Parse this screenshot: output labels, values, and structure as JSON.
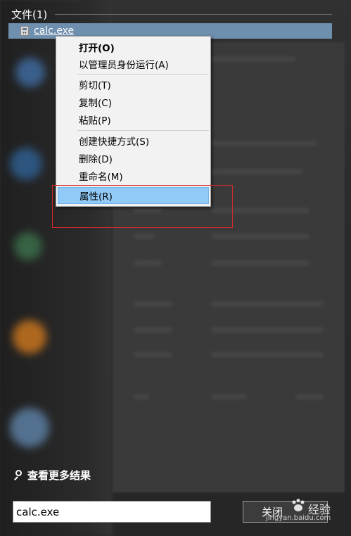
{
  "header": {
    "files_label": "文件(1)"
  },
  "results": {
    "selected_file": "calc.exe"
  },
  "context_menu": {
    "items": [
      {
        "label": "打开(O)"
      },
      {
        "label": "以管理员身份运行(A)"
      },
      {
        "label": "剪切(T)"
      },
      {
        "label": "复制(C)"
      },
      {
        "label": "粘贴(P)"
      },
      {
        "label": "创建快捷方式(S)"
      },
      {
        "label": "删除(D)"
      },
      {
        "label": "重命名(M)"
      },
      {
        "label": "属性(R)"
      }
    ],
    "highlight_color": "#91c9f7"
  },
  "footer": {
    "see_more_label": "查看更多结果",
    "search_value": "calc.exe",
    "close_button_label": "关闭"
  },
  "watermark": {
    "text": "经验",
    "url": "jingyan.baidu.com"
  },
  "annotation": {
    "color": "#d22a2a"
  }
}
